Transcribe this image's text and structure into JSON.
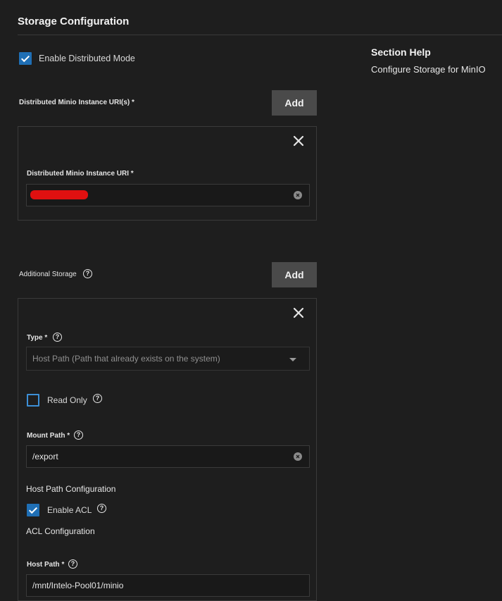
{
  "section": {
    "title": "Storage Configuration",
    "enable_distributed_label": "Enable Distributed Mode",
    "enable_distributed_checked": true
  },
  "help": {
    "title": "Section Help",
    "text": "Configure Storage for MinIO"
  },
  "distributed": {
    "list_label": "Distributed Minio Instance URI(s) *",
    "add_label": "Add",
    "item_label": "Distributed Minio Instance URI *",
    "item_value": ""
  },
  "additional": {
    "list_label": "Additional Storage",
    "add_label": "Add",
    "type_label": "Type *",
    "type_value": "Host Path (Path that already exists on the system)",
    "read_only_label": "Read Only",
    "read_only_checked": false,
    "mount_path_label": "Mount Path *",
    "mount_path_value": "/export",
    "host_path_config_label": "Host Path Configuration",
    "enable_acl_label": "Enable ACL",
    "enable_acl_checked": true,
    "acl_config_label": "ACL Configuration",
    "host_path_label": "Host Path *",
    "host_path_value": "/mnt/Intelo-Pool01/minio"
  },
  "colors": {
    "accent": "#1f6fb5",
    "redaction": "#e01010",
    "background": "#1e1e1e"
  }
}
